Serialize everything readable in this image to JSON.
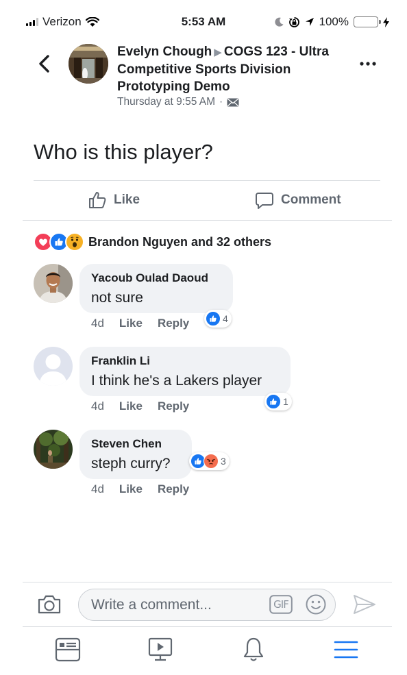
{
  "status_bar": {
    "carrier": "Verizon",
    "time": "5:53 AM",
    "battery": "100%"
  },
  "post": {
    "author": "Evelyn Chough",
    "group": "COGS 123 - Ultra Competitive Sports Division Prototyping Demo",
    "timestamp": "Thursday at 9:55 AM",
    "separator": "·",
    "text": "Who is this player?"
  },
  "actions": {
    "like_label": "Like",
    "comment_label": "Comment"
  },
  "reactions": {
    "summary": "Brandon Nguyen and 32 others",
    "icons": [
      "love-icon",
      "like-icon",
      "wow-icon"
    ]
  },
  "comments": [
    {
      "name": "Yacoub Oulad Daoud",
      "text": "not sure",
      "age": "4d",
      "like_label": "Like",
      "reply_label": "Reply",
      "reaction_count": "4",
      "reaction_icons": [
        "like-icon"
      ]
    },
    {
      "name": "Franklin Li",
      "text": "I think he's a Lakers player",
      "age": "4d",
      "like_label": "Like",
      "reply_label": "Reply",
      "reaction_count": "1",
      "reaction_icons": [
        "like-icon"
      ]
    },
    {
      "name": "Steven Chen",
      "text": "steph curry?",
      "age": "4d",
      "like_label": "Like",
      "reply_label": "Reply",
      "reaction_count": "3",
      "reaction_icons": [
        "like-icon",
        "angry-icon"
      ]
    }
  ],
  "composer": {
    "placeholder": "Write a comment...",
    "gif_label": "GIF"
  },
  "tab_bar": {
    "tabs": [
      "news-feed-icon",
      "watch-icon",
      "notifications-icon",
      "menu-icon"
    ],
    "active": "menu-icon"
  },
  "colors": {
    "facebook_blue": "#1877f2",
    "text_primary": "#1c1e21",
    "text_secondary": "#606770",
    "bubble_gray": "#f0f2f5",
    "love_red": "#f33e58",
    "battery_green": "#4cd964"
  }
}
